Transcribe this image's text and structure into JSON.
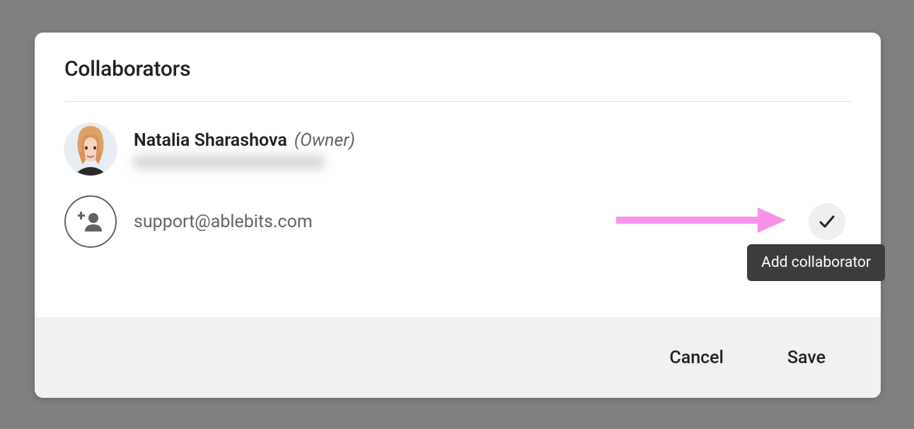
{
  "dialog": {
    "title": "Collaborators"
  },
  "owner": {
    "name": "Natalia Sharashova",
    "role": "(Owner)"
  },
  "add_collaborator": {
    "email": "support@ablebits.com"
  },
  "tooltip": {
    "add": "Add collaborator"
  },
  "actions": {
    "cancel": "Cancel",
    "save": "Save"
  }
}
